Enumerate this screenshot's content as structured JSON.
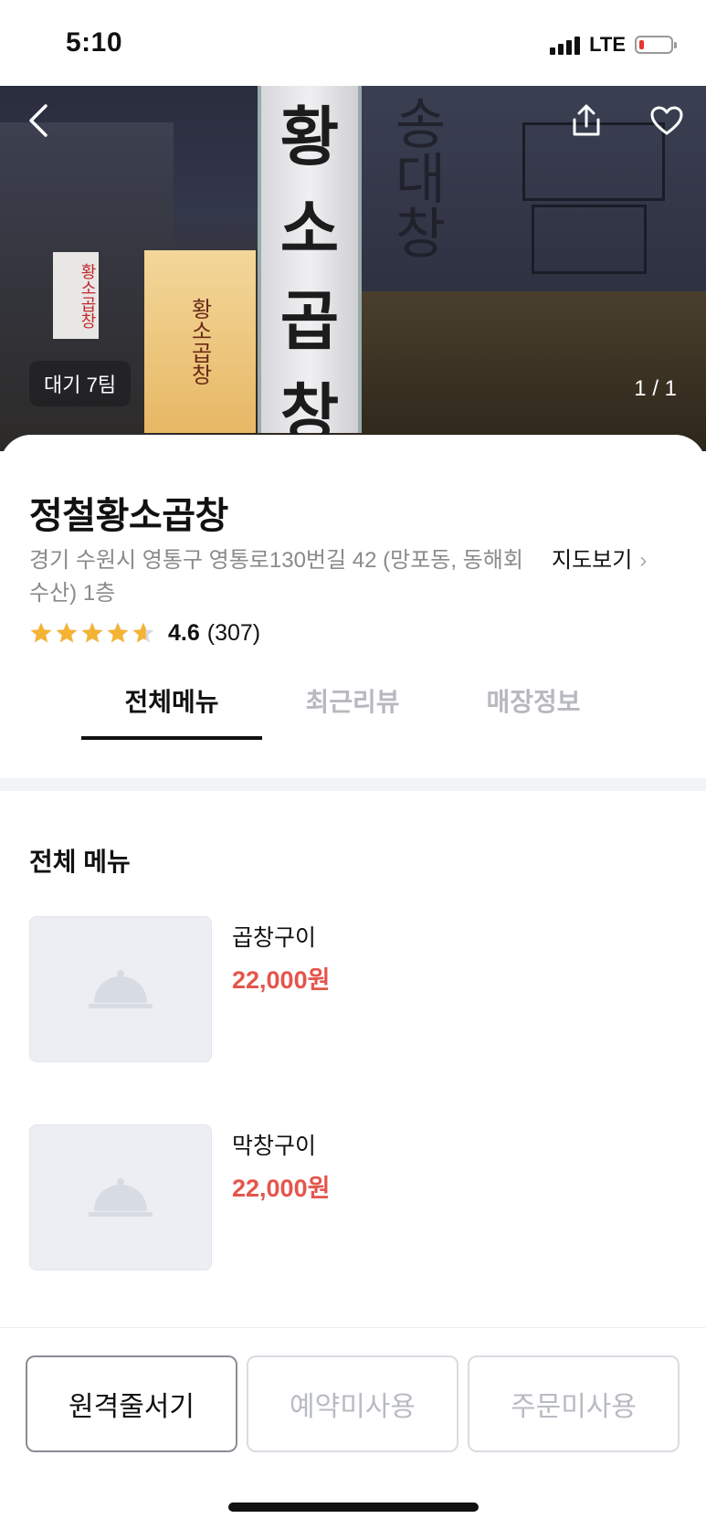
{
  "status_bar": {
    "time": "5:10",
    "network": "LTE"
  },
  "hero": {
    "wait_badge": "대기 7팀",
    "photo_counter": "1 / 1",
    "sign_text": [
      "황",
      "소",
      "곱",
      "창"
    ],
    "side_sign_text": "황소곱창",
    "small_sign_text": "황소곱창",
    "wall_text": "송대창"
  },
  "store": {
    "name": "정철황소곱창",
    "address": "경기 수원시 영통구 영통로130번길 42 (망포동, 동해회수산) 1층",
    "map_link": "지도보기",
    "rating": "4.6",
    "review_count": "(307)",
    "stars": 4.6
  },
  "tabs": [
    {
      "label": "전체메뉴",
      "active": true
    },
    {
      "label": "최근리뷰",
      "active": false
    },
    {
      "label": "매장정보",
      "active": false
    }
  ],
  "menu": {
    "section_title": "전체 메뉴",
    "items": [
      {
        "name": "곱창구이",
        "price": "22,000원"
      },
      {
        "name": "막창구이",
        "price": "22,000원"
      }
    ]
  },
  "bottom_bar": {
    "remote_queue": "원격줄서기",
    "reservation": "예약미사용",
    "order": "주문미사용"
  },
  "colors": {
    "accent_price": "#e4554c",
    "star": "#f5b335",
    "disabled_text": "#b8bbc2"
  }
}
